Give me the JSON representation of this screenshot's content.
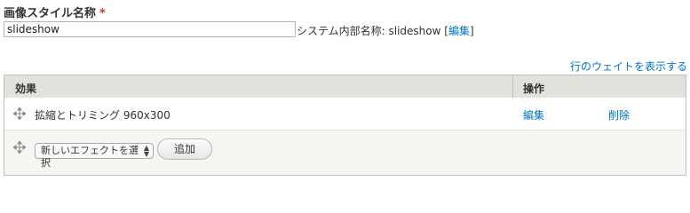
{
  "form": {
    "name_label": "画像スタイル名称",
    "required_mark": "*",
    "name_value": "slideshow",
    "machine_name_prefix": "システム内部名称: slideshow ",
    "machine_name_open": "[",
    "machine_name_edit": "編集",
    "machine_name_close": "]"
  },
  "table": {
    "show_weights_link": "行のウェイトを表示する",
    "header_effect": "効果",
    "header_operations": "操作",
    "rows": [
      {
        "effect": "拡縮とトリミング 960x300",
        "edit": "編集",
        "delete": "削除"
      }
    ],
    "new_effect_select": "新しいエフェクトを選択",
    "add_button": "追加"
  },
  "colors": {
    "link": "#0074bd",
    "required": "#e03131",
    "header_bg": "#e1e2dc"
  }
}
